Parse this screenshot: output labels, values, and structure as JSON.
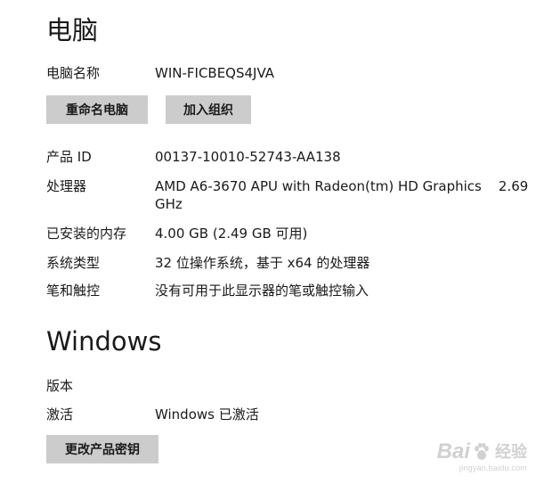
{
  "pc_section": {
    "title": "电脑",
    "pc_name_label": "电脑名称",
    "pc_name_value": "WIN-FICBEQS4JVA",
    "rename_button": "重命名电脑",
    "join_org_button": "加入组织",
    "specs": [
      {
        "label": "产品 ID",
        "value": "00137-10010-52743-AA138"
      },
      {
        "label": "处理器",
        "value": "AMD A6-3670 APU with Radeon(tm) HD Graphics    2.69 GHz"
      },
      {
        "label": "已安装的内存",
        "value": "4.00 GB (2.49 GB 可用)"
      },
      {
        "label": "系统类型",
        "value": "32 位操作系统，基于 x64 的处理器"
      },
      {
        "label": "笔和触控",
        "value": "没有可用于此显示器的笔或触控输入"
      }
    ]
  },
  "windows_section": {
    "title": "Windows",
    "edition_label": "版本",
    "edition_value": "",
    "activation_label": "激活",
    "activation_value": "Windows 已激活",
    "change_key_button": "更改产品密钥"
  },
  "watermark": {
    "brand_prefix": "Bai",
    "brand_suffix": "经验",
    "url": "jingyan.baidu.com"
  },
  "colors": {
    "button_bg": "#cccccc",
    "text": "#1a1a1a",
    "background": "#ffffff"
  }
}
